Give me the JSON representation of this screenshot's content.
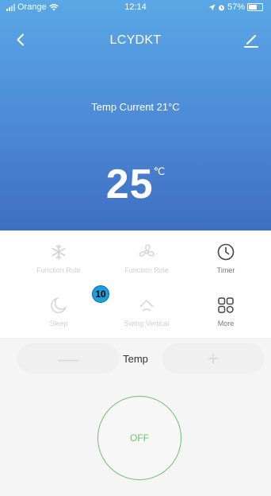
{
  "status_bar": {
    "carrier": "Orange",
    "time": "12:14",
    "battery": "57%",
    "battery_level": 0.57,
    "icons": [
      "signal-icon",
      "wifi-icon",
      "location-icon",
      "alarm-icon",
      "battery-icon"
    ]
  },
  "nav": {
    "title": "LCYDKT",
    "back_icon": "chevron-left-icon",
    "edit_icon": "pencil-icon"
  },
  "hero": {
    "temp_current_label": "Temp Current  21°C",
    "set_temp": "25",
    "set_temp_unit": "℃",
    "gradient_colors": [
      "#5aa8e6",
      "#4f8fd8",
      "#3f6fc2"
    ]
  },
  "functions": [
    {
      "label": "Function Rule",
      "icon": "snowflake-icon",
      "active": false
    },
    {
      "label": "Function Role",
      "icon": "fan-icon",
      "active": false
    },
    {
      "label": "Timer",
      "icon": "clock-icon",
      "active": true
    },
    {
      "label": "Sleep",
      "icon": "moon-icon",
      "active": false
    },
    {
      "label": "Swing Vertical",
      "icon": "swing-icon",
      "active": false
    },
    {
      "label": "More",
      "icon": "grid-icon",
      "active": true
    }
  ],
  "badge": {
    "value": "10",
    "color": "#1a9fe0"
  },
  "control": {
    "temp_label": "Temp",
    "minus_symbol": "—",
    "plus_symbol": "+",
    "power_label": "OFF",
    "power_color": "#6cc26f"
  }
}
